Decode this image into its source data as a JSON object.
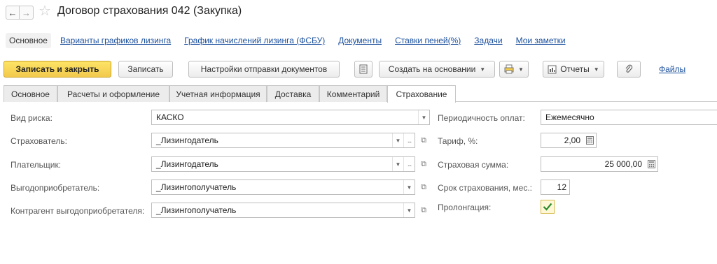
{
  "window": {
    "title": "Договор страхования 042 (Закупка)"
  },
  "icons": {
    "back": "arrow-left",
    "forward": "arrow-right",
    "favorite": "star",
    "list": "document-list",
    "print": "printer",
    "reports": "report",
    "attach": "paperclip",
    "open": "open-window",
    "calculator": "calculator",
    "check": "checkmark"
  },
  "nav": {
    "items": [
      "Основное",
      "Варианты графиков лизинга",
      "График начислений лизинга (ФСБУ)",
      "Документы",
      "Ставки пеней(%)",
      "Задачи",
      "Мои заметки"
    ]
  },
  "toolbar": {
    "save_close": "Записать и закрыть",
    "save": "Записать",
    "send_settings": "Настройки отправки документов",
    "create_based": "Создать на основании",
    "reports": "Отчеты",
    "files": "Файлы"
  },
  "tabs": [
    "Основное",
    "Расчеты и оформление",
    "Учетная информация",
    "Доставка",
    "Комментарий",
    "Страхование"
  ],
  "form": {
    "risk_type": {
      "label": "Вид риска:",
      "value": "КАСКО"
    },
    "insurer": {
      "label": "Страхователь:",
      "value": "_Лизингодатель"
    },
    "payer": {
      "label": "Плательщик:",
      "value": "_Лизингодатель"
    },
    "beneficiary": {
      "label": "Выгодоприобретатель:",
      "value": "_Лизингополучатель"
    },
    "beneficiary_contractor": {
      "label": "Контрагент выгодоприобретателя:",
      "value": "_Лизингополучатель"
    },
    "payment_frequency": {
      "label": "Периодичность оплат:",
      "value": "Ежемесячно"
    },
    "tariff": {
      "label": "Тариф, %:",
      "value": "2,00"
    },
    "insured_sum": {
      "label": "Страховая сумма:",
      "value": "25 000,00"
    },
    "term": {
      "label": "Срок страхования, мес.:",
      "value": "12"
    },
    "prolongation": {
      "label": "Пролонгация:",
      "checked": true
    }
  },
  "colors": {
    "accent_yellow": "#f2c94c",
    "link": "#1b4f9c"
  }
}
